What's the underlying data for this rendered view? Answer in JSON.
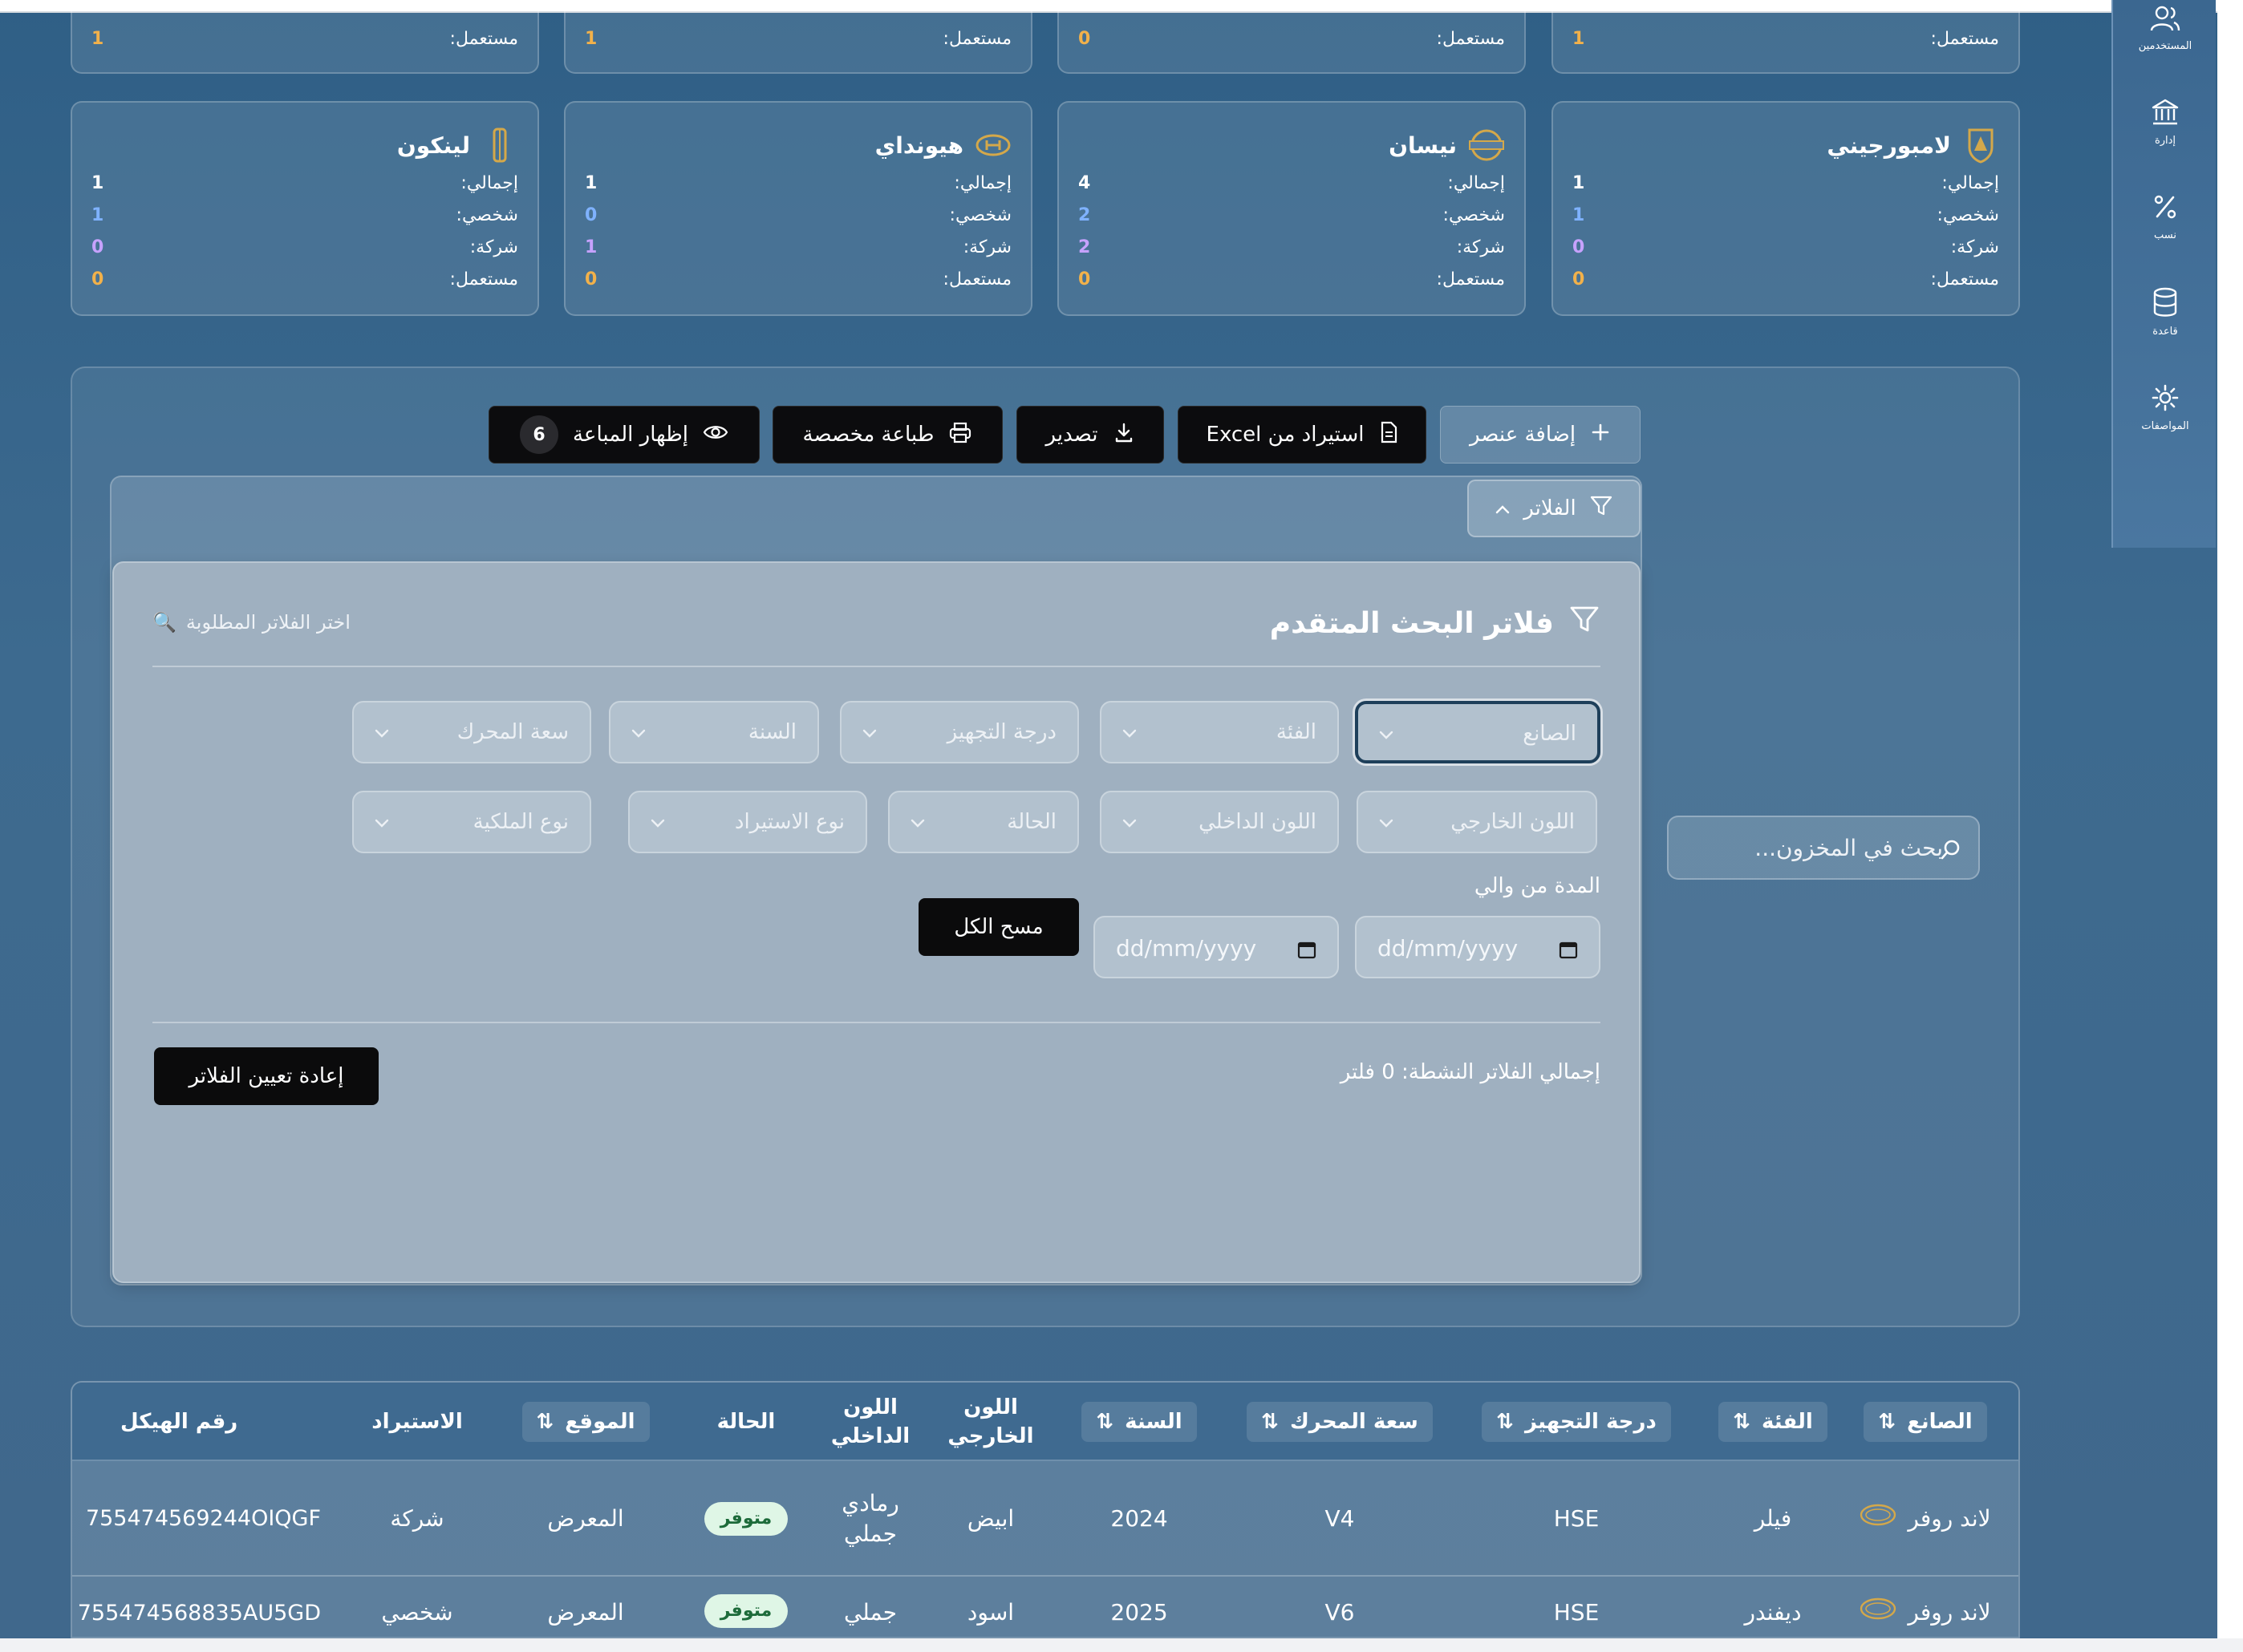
{
  "colors": {
    "personal": "#7fb2ff",
    "company": "#c7a2ff",
    "used": "#f2b14a"
  },
  "sidebar": {
    "items": [
      {
        "label": "المستخدمين",
        "icon": "users-icon"
      },
      {
        "label": "إدارة",
        "icon": "bank-icon"
      },
      {
        "label": "نسب",
        "icon": "percent-icon"
      },
      {
        "label": "قاعدة",
        "icon": "database-icon"
      },
      {
        "label": "المواصفات",
        "icon": "gear-icon"
      }
    ]
  },
  "cards_top_partial": [
    {
      "used_label": "مستعمل:",
      "used": "1"
    },
    {
      "used_label": "مستعمل:",
      "used": "1"
    },
    {
      "used_label": "مستعمل:",
      "used": "0"
    },
    {
      "used_label": "مستعمل:",
      "used": "1"
    }
  ],
  "cards": [
    {
      "brand": "لامبورجيني",
      "total_label": "إجمالي:",
      "total": "1",
      "personal_label": "شخصي:",
      "personal": "1",
      "company_label": "شركة:",
      "company": "0",
      "used_label": "مستعمل:",
      "used": "0"
    },
    {
      "brand": "نيسان",
      "total_label": "إجمالي:",
      "total": "4",
      "personal_label": "شخصي:",
      "personal": "2",
      "company_label": "شركة:",
      "company": "2",
      "used_label": "مستعمل:",
      "used": "0"
    },
    {
      "brand": "هيونداي",
      "total_label": "إجمالي:",
      "total": "1",
      "personal_label": "شخصي:",
      "personal": "0",
      "company_label": "شركة:",
      "company": "1",
      "used_label": "مستعمل:",
      "used": "0"
    },
    {
      "brand": "لينكون",
      "total_label": "إجمالي:",
      "total": "1",
      "personal_label": "شخصي:",
      "personal": "1",
      "company_label": "شركة:",
      "company": "0",
      "used_label": "مستعمل:",
      "used": "0"
    }
  ],
  "toolbar": {
    "add_label": "إضافة عنصر",
    "import_label": "استيراد من Excel",
    "export_label": "تصدير",
    "print_label": "طباعة مخصصة",
    "show_sold_label": "إظهار المباعة",
    "show_sold_count": "6"
  },
  "filters_toggle_label": "الفلاتر",
  "advanced": {
    "title": "فلاتر البحث المتقدم",
    "hint": "اختر الفلاتر المطلوبة",
    "hint_emoji": "🔍",
    "row1": [
      "الصانع",
      "الفئة",
      "درجة التجهيز",
      "السنة",
      "سعة المحرك"
    ],
    "row2": [
      "اللون الخارجي",
      "اللون الداخلي",
      "الحالة",
      "نوع الاستيراد",
      "نوع الملكية"
    ],
    "date_label": "المدة من والي",
    "date_from_placeholder": "dd/mm/yyyy",
    "date_to_placeholder": "dd/mm/yyyy",
    "clear_all_label": "مسح الكل",
    "active_total": "إجمالي الفلاتر النشطة: 0 فلتر",
    "reset_label": "إعادة تعيين الفلاتر"
  },
  "search": {
    "placeholder": "بحث في المخزون..."
  },
  "table": {
    "headers": [
      "الصانع",
      "الفئة",
      "درجة التجهيز",
      "سعة المحرك",
      "السنة",
      "اللون الخارجي",
      "اللون الداخلي",
      "الحالة",
      "الموقع",
      "الاستيراد",
      "رقم الهيكل"
    ],
    "rows": [
      [
        "لاند روفر",
        "فيلر",
        "HSE",
        "V4",
        "2024",
        "ابيض",
        "رمادي جملي",
        "متوفر",
        "المعرض",
        "شركة",
        "755474569244OIQGF"
      ],
      [
        "لاند روفر",
        "ديفندر",
        "HSE",
        "V6",
        "2025",
        "اسود",
        "جملي",
        "متوفر",
        "المعرض",
        "شخصي",
        "755474568835AU5GD"
      ]
    ]
  }
}
